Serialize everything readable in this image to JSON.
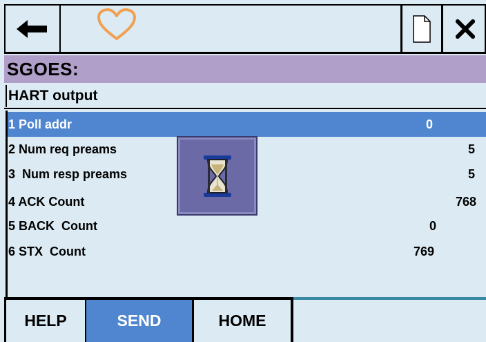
{
  "toolbar": {
    "back_icon": "back-arrow-icon",
    "favorite_icon": "heart-outline-icon",
    "document_icon": "document-icon",
    "close_icon": "close-x-icon",
    "accent_heart": "#f0a050"
  },
  "title": "SGOES:",
  "subtitle": "HART output",
  "rows": [
    {
      "label": "1 Poll addr",
      "value": "0",
      "selected": true
    },
    {
      "label": "2 Num req preams",
      "value": "5",
      "selected": false
    },
    {
      "label": "3  Num resp preams",
      "value": "5",
      "selected": false
    },
    {
      "label": "4 ACK Count",
      "value": "768",
      "selected": false
    },
    {
      "label": "5 BACK  Count",
      "value": "0",
      "selected": false
    },
    {
      "label": "6 STX  Count",
      "value": "769",
      "selected": false
    }
  ],
  "busy_indicator": "hourglass-icon",
  "buttons": {
    "help": "HELP",
    "send": "SEND",
    "home": "HOME"
  },
  "colors": {
    "background": "#dcebf3",
    "title_bar": "#b09fc8",
    "selection": "#4f86cf"
  }
}
